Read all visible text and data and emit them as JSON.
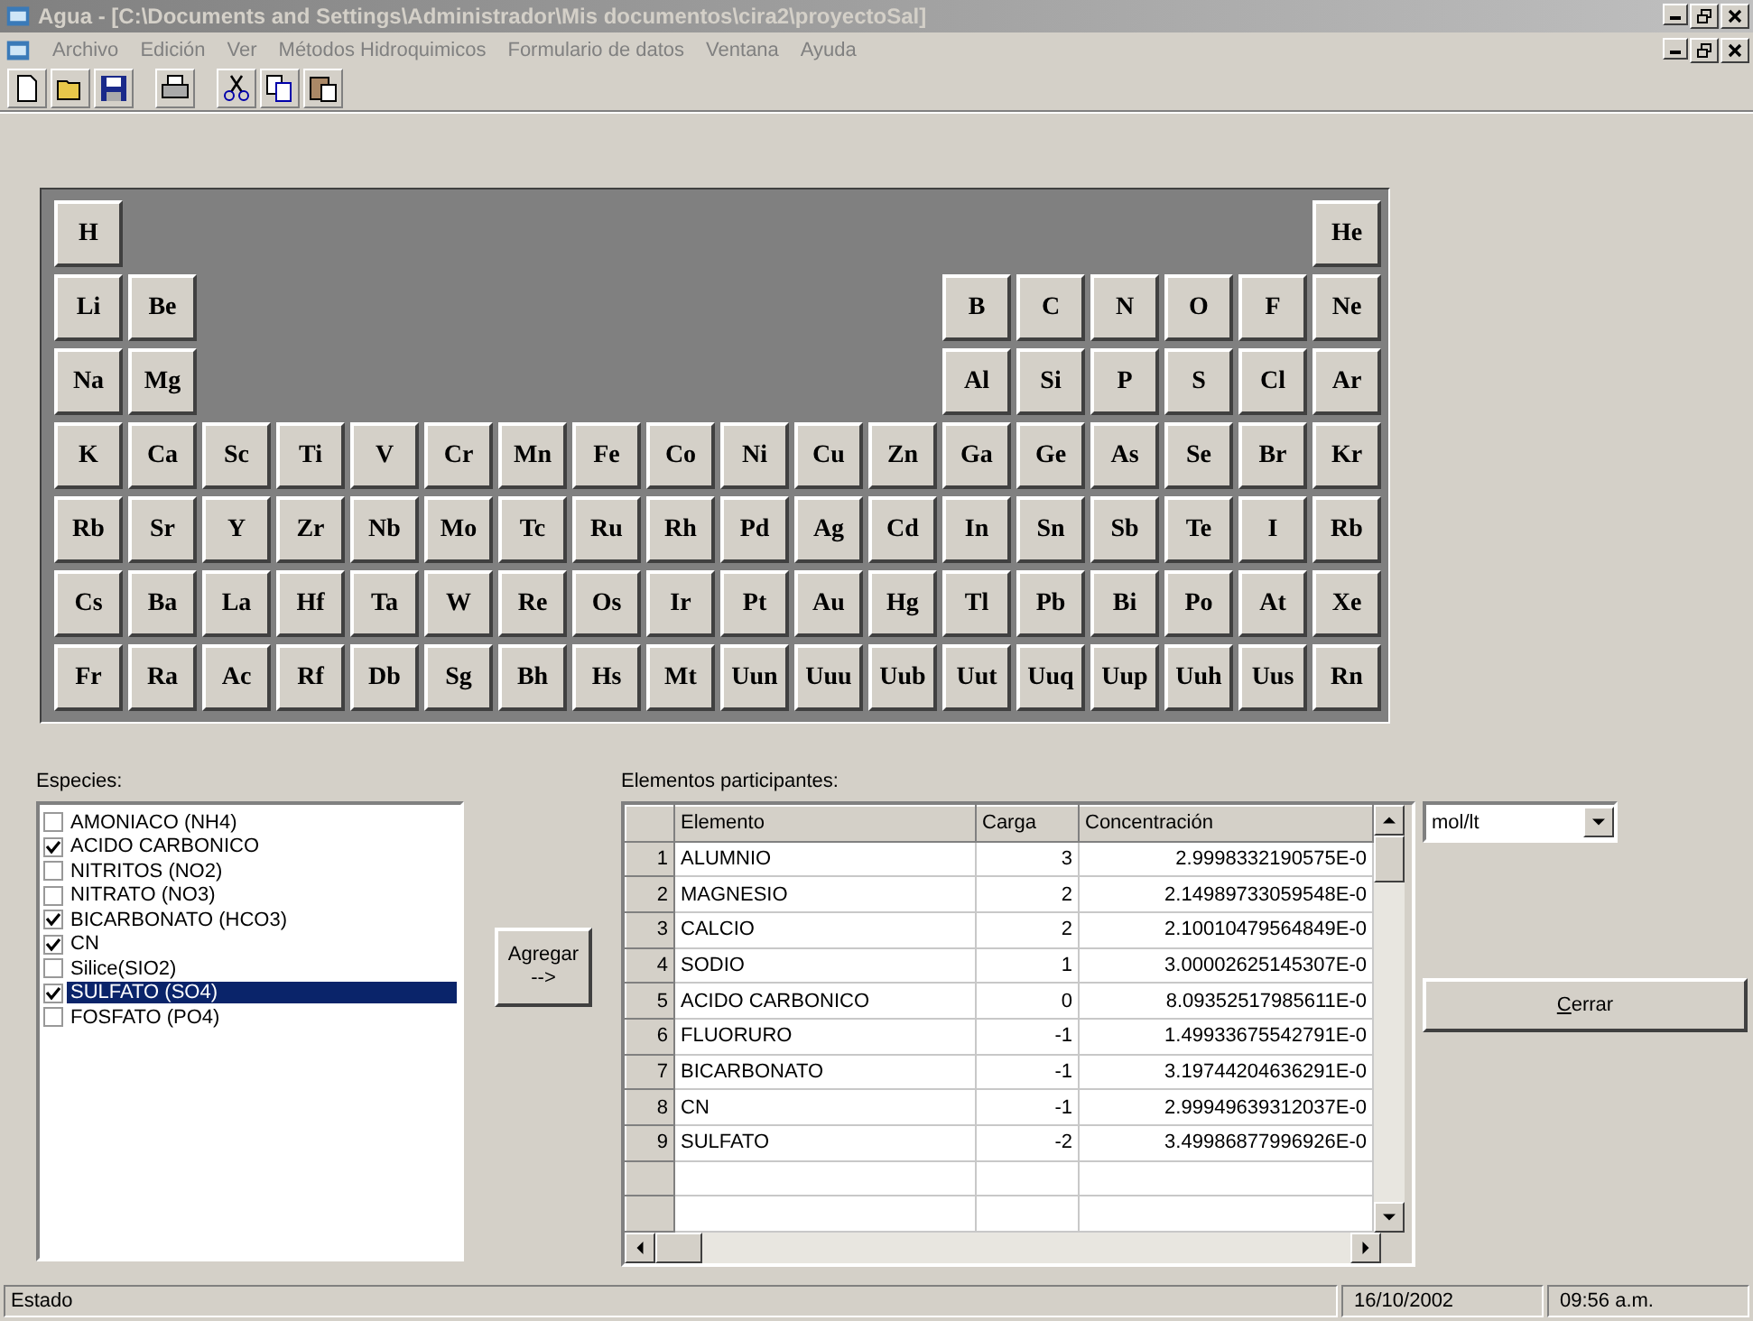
{
  "window": {
    "title": "Agua - [C:\\Documents and Settings\\Administrador\\Mis documentos\\cira2\\proyectoSal]"
  },
  "menu": [
    "Archivo",
    "Edición",
    "Ver",
    "Métodos Hidroquimicos",
    "Formulario de datos",
    "Ventana",
    "Ayuda"
  ],
  "periodic_table": {
    "rows": [
      [
        "H",
        null,
        null,
        null,
        null,
        null,
        null,
        null,
        null,
        null,
        null,
        null,
        null,
        null,
        null,
        null,
        null,
        "He"
      ],
      [
        "Li",
        "Be",
        null,
        null,
        null,
        null,
        null,
        null,
        null,
        null,
        null,
        null,
        "B",
        "C",
        "N",
        "O",
        "F",
        "Ne"
      ],
      [
        "Na",
        "Mg",
        null,
        null,
        null,
        null,
        null,
        null,
        null,
        null,
        null,
        null,
        "Al",
        "Si",
        "P",
        "S",
        "Cl",
        "Ar"
      ],
      [
        "K",
        "Ca",
        "Sc",
        "Ti",
        "V",
        "Cr",
        "Mn",
        "Fe",
        "Co",
        "Ni",
        "Cu",
        "Zn",
        "Ga",
        "Ge",
        "As",
        "Se",
        "Br",
        "Kr"
      ],
      [
        "Rb",
        "Sr",
        "Y",
        "Zr",
        "Nb",
        "Mo",
        "Tc",
        "Ru",
        "Rh",
        "Pd",
        "Ag",
        "Cd",
        "In",
        "Sn",
        "Sb",
        "Te",
        "I",
        "Rb"
      ],
      [
        "Cs",
        "Ba",
        "La",
        "Hf",
        "Ta",
        "W",
        "Re",
        "Os",
        "Ir",
        "Pt",
        "Au",
        "Hg",
        "Tl",
        "Pb",
        "Bi",
        "Po",
        "At",
        "Xe"
      ],
      [
        "Fr",
        "Ra",
        "Ac",
        "Rf",
        "Db",
        "Sg",
        "Bh",
        "Hs",
        "Mt",
        "Uun",
        "Uuu",
        "Uub",
        "Uut",
        "Uuq",
        "Uup",
        "Uuh",
        "Uus",
        "Rn"
      ]
    ]
  },
  "species": {
    "label": "Especies:",
    "items": [
      {
        "name": "AMONIACO (NH4)",
        "checked": false,
        "selected": false
      },
      {
        "name": "ACIDO CARBONICO",
        "checked": true,
        "selected": false
      },
      {
        "name": "NITRITOS (NO2)",
        "checked": false,
        "selected": false
      },
      {
        "name": "NITRATO (NO3)",
        "checked": false,
        "selected": false
      },
      {
        "name": "BICARBONATO (HCO3)",
        "checked": true,
        "selected": false
      },
      {
        "name": "CN",
        "checked": true,
        "selected": false
      },
      {
        "name": "Silice(SIO2)",
        "checked": false,
        "selected": false
      },
      {
        "name": "SULFATO (SO4)",
        "checked": true,
        "selected": true
      },
      {
        "name": "FOSFATO (PO4)",
        "checked": false,
        "selected": false
      }
    ]
  },
  "add_button": {
    "line1": "Agregar",
    "line2": "-->"
  },
  "participants": {
    "label": "Elementos participantes:",
    "columns": [
      "Elemento",
      "Carga",
      "Concentración"
    ],
    "rows": [
      {
        "number": "1",
        "cells": [
          "ALUMNIO",
          "3",
          "2.9998332190575E-0"
        ]
      },
      {
        "number": "2",
        "cells": [
          "MAGNESIO",
          "2",
          "2.14989733059548E-0"
        ]
      },
      {
        "number": "3",
        "cells": [
          "CALCIO",
          "2",
          "2.10010479564849E-0"
        ]
      },
      {
        "number": "4",
        "cells": [
          "SODIO",
          "1",
          "3.00002625145307E-0"
        ]
      },
      {
        "number": "5",
        "cells": [
          "ACIDO CARBONICO",
          "0",
          "8.09352517985611E-0"
        ]
      },
      {
        "number": "6",
        "cells": [
          "FLUORURO",
          "-1",
          "1.49933675542791E-0"
        ]
      },
      {
        "number": "7",
        "cells": [
          "BICARBONATO",
          "-1",
          "3.19744204636291E-0"
        ]
      },
      {
        "number": "8",
        "cells": [
          "CN",
          "-1",
          "2.99949639312037E-0"
        ]
      },
      {
        "number": "9",
        "cells": [
          "SULFATO",
          "-2",
          "3.49986877996926E-0"
        ]
      }
    ]
  },
  "unit_select": {
    "value": "mol/lt"
  },
  "close_button": {
    "label": "Cerrar"
  },
  "status_bar": {
    "text": "Estado",
    "date": "16/10/2002",
    "time": "09:56 a.m."
  }
}
